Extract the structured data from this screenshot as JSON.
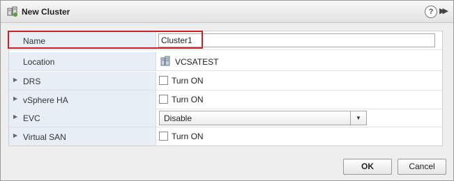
{
  "dialog": {
    "title": "New Cluster"
  },
  "header": {
    "help_icon": "help-icon",
    "expand_icon": "expand-icon",
    "help_glyph": "?",
    "expand_glyph": "▶▶"
  },
  "fields": {
    "name": {
      "label": "Name",
      "value": "Cluster1"
    },
    "location": {
      "label": "Location",
      "value": "VCSATEST",
      "icon": "datacenter-icon"
    },
    "drs": {
      "label": "DRS",
      "checkbox_label": "Turn ON",
      "checked": false
    },
    "vsphere_ha": {
      "label": "vSphere HA",
      "checkbox_label": "Turn ON",
      "checked": false
    },
    "evc": {
      "label": "EVC",
      "selected": "Disable"
    },
    "virtual_san": {
      "label": "Virtual SAN",
      "checkbox_label": "Turn ON",
      "checked": false
    }
  },
  "buttons": {
    "ok": "OK",
    "cancel": "Cancel"
  },
  "colors": {
    "highlight": "#d21f25",
    "label_bg": "#e8eef5"
  }
}
